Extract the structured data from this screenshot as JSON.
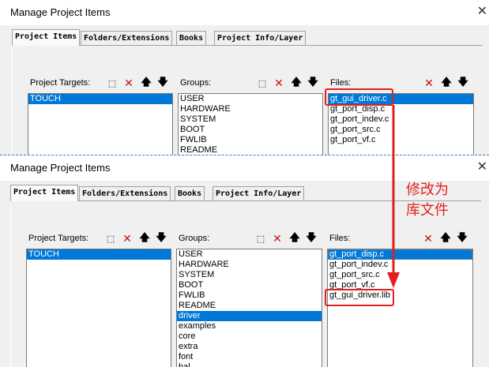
{
  "top_dialog": {
    "title": "Manage Project Items",
    "tabs": [
      "Project Items",
      "Folders/Extensions",
      "Books",
      "Project Info/Layer"
    ],
    "targets_label": "Project Targets:",
    "groups_label": "Groups:",
    "files_label": "Files:",
    "targets": [
      "TOUCH"
    ],
    "groups": [
      "USER",
      "HARDWARE",
      "SYSTEM",
      "BOOT",
      "FWLIB",
      "README"
    ],
    "files": [
      "gt_gui_driver.c",
      "gt_port_disp.c",
      "gt_port_indev.c",
      "gt_port_src.c",
      "gt_port_vf.c"
    ]
  },
  "bottom_dialog": {
    "title": "Manage Project Items",
    "tabs": [
      "Project Items",
      "Folders/Extensions",
      "Books",
      "Project Info/Layer"
    ],
    "targets_label": "Project Targets:",
    "groups_label": "Groups:",
    "files_label": "Files:",
    "targets": [
      "TOUCH"
    ],
    "groups": [
      "USER",
      "HARDWARE",
      "SYSTEM",
      "BOOT",
      "FWLIB",
      "README",
      "driver",
      "examples",
      "core",
      "extra",
      "font",
      "hal"
    ],
    "files": [
      "gt_port_disp.c",
      "gt_port_indev.c",
      "gt_port_src.c",
      "gt_port_vf.c",
      "gt_gui_driver.lib"
    ]
  },
  "annotation": {
    "line1": "修改为",
    "line2": "库文件"
  },
  "colors": {
    "selection": "#0078d7",
    "highlight_box": "#e02020",
    "annotation_text": "#e02020"
  }
}
